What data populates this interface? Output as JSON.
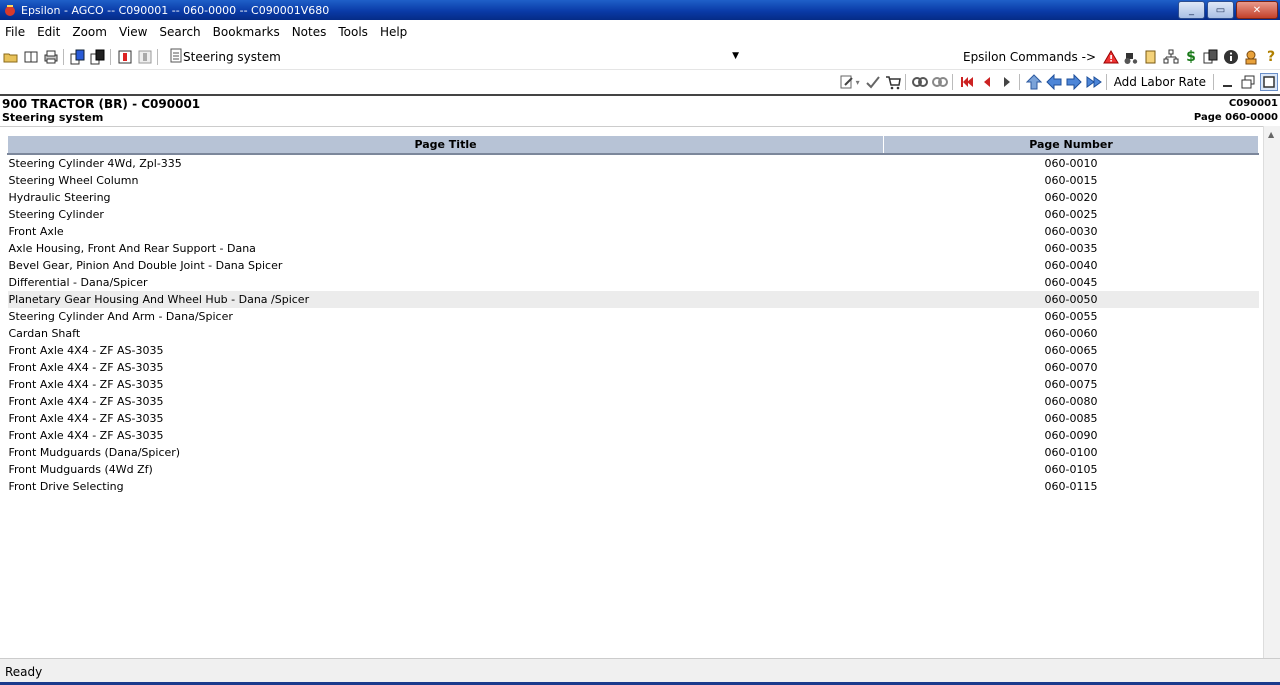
{
  "window": {
    "title": "Epsilon - AGCO -- C090001 -- 060-0000 -- C090001V680",
    "minimize": "_",
    "maximize": "▭",
    "close": "✕"
  },
  "menu": [
    "File",
    "Edit",
    "Zoom",
    "View",
    "Search",
    "Bookmarks",
    "Notes",
    "Tools",
    "Help"
  ],
  "toolbar": {
    "location_value": "Steering system",
    "epsilon_commands_label": "Epsilon Commands ->",
    "add_labor_rate_label": "Add Labor Rate"
  },
  "header": {
    "model": "900 TRACTOR (BR) - C090001",
    "model_code": "C090001",
    "section": "Steering system",
    "page": "Page 060-0000"
  },
  "table": {
    "columns": [
      "Page Title",
      "Page Number"
    ],
    "rows": [
      {
        "title": "Steering Cylinder 4Wd, Zpl-335",
        "number": "060-0010"
      },
      {
        "title": "Steering Wheel Column",
        "number": "060-0015"
      },
      {
        "title": "Hydraulic Steering",
        "number": "060-0020"
      },
      {
        "title": "Steering Cylinder",
        "number": "060-0025"
      },
      {
        "title": "Front Axle",
        "number": "060-0030"
      },
      {
        "title": "Axle Housing, Front And Rear Support - Dana",
        "number": "060-0035"
      },
      {
        "title": "Bevel Gear, Pinion And Double Joint - Dana Spicer",
        "number": "060-0040"
      },
      {
        "title": "Differential - Dana/Spicer",
        "number": "060-0045"
      },
      {
        "title": "Planetary Gear Housing And Wheel Hub - Dana /Spicer",
        "number": "060-0050"
      },
      {
        "title": "Steering Cylinder And Arm - Dana/Spicer",
        "number": "060-0055"
      },
      {
        "title": "Cardan Shaft",
        "number": "060-0060"
      },
      {
        "title": "Front Axle 4X4 - ZF AS-3035",
        "number": "060-0065"
      },
      {
        "title": "Front Axle 4X4 - ZF AS-3035",
        "number": "060-0070"
      },
      {
        "title": "Front Axle 4X4 - ZF AS-3035",
        "number": "060-0075"
      },
      {
        "title": "Front Axle 4X4 - ZF AS-3035",
        "number": "060-0080"
      },
      {
        "title": "Front Axle 4X4 - ZF AS-3035",
        "number": "060-0085"
      },
      {
        "title": "Front Axle 4X4 - ZF AS-3035",
        "number": "060-0090"
      },
      {
        "title": "Front Mudguards (Dana/Spicer)",
        "number": "060-0100"
      },
      {
        "title": "Front Mudguards (4Wd Zf)",
        "number": "060-0105"
      },
      {
        "title": "Front Drive Selecting",
        "number": "060-0115"
      }
    ],
    "selected_row": 8
  },
  "status": {
    "text": "Ready"
  },
  "colors": {
    "titlebar": "#0a3ba8",
    "table_header": "#b7c3d6",
    "selected_row": "#ececec"
  }
}
